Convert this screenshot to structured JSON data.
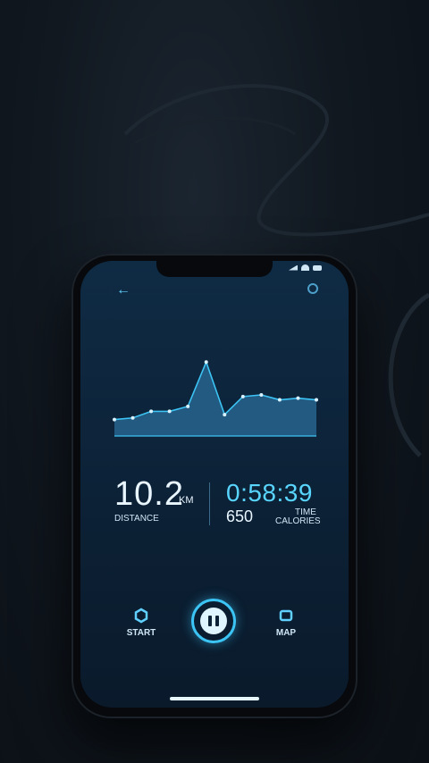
{
  "colors": {
    "accent": "#3cc4f5",
    "background": "#0c2136",
    "chart_fill": "#2a6c99"
  },
  "header": {
    "back_icon": "arrow-left-icon",
    "settings_icon": "settings-icon"
  },
  "chart_data": {
    "type": "area",
    "x": [
      0,
      1,
      2,
      3,
      4,
      5,
      6,
      7,
      8,
      9,
      10,
      11
    ],
    "values": [
      20,
      22,
      30,
      30,
      36,
      90,
      26,
      48,
      50,
      44,
      46,
      44
    ]
  },
  "stats": {
    "distance_value": "10.2",
    "distance_unit": "KM",
    "distance_label": "DISTANCE",
    "time_value": "0:58:39",
    "time_label": "TIME",
    "calories_value": "650",
    "calories_label": "CALORIES"
  },
  "controls": {
    "start_label": "START",
    "start_icon": "hexagon-icon",
    "pause_icon": "pause-icon",
    "map_label": "MAP",
    "map_icon": "map-icon"
  }
}
